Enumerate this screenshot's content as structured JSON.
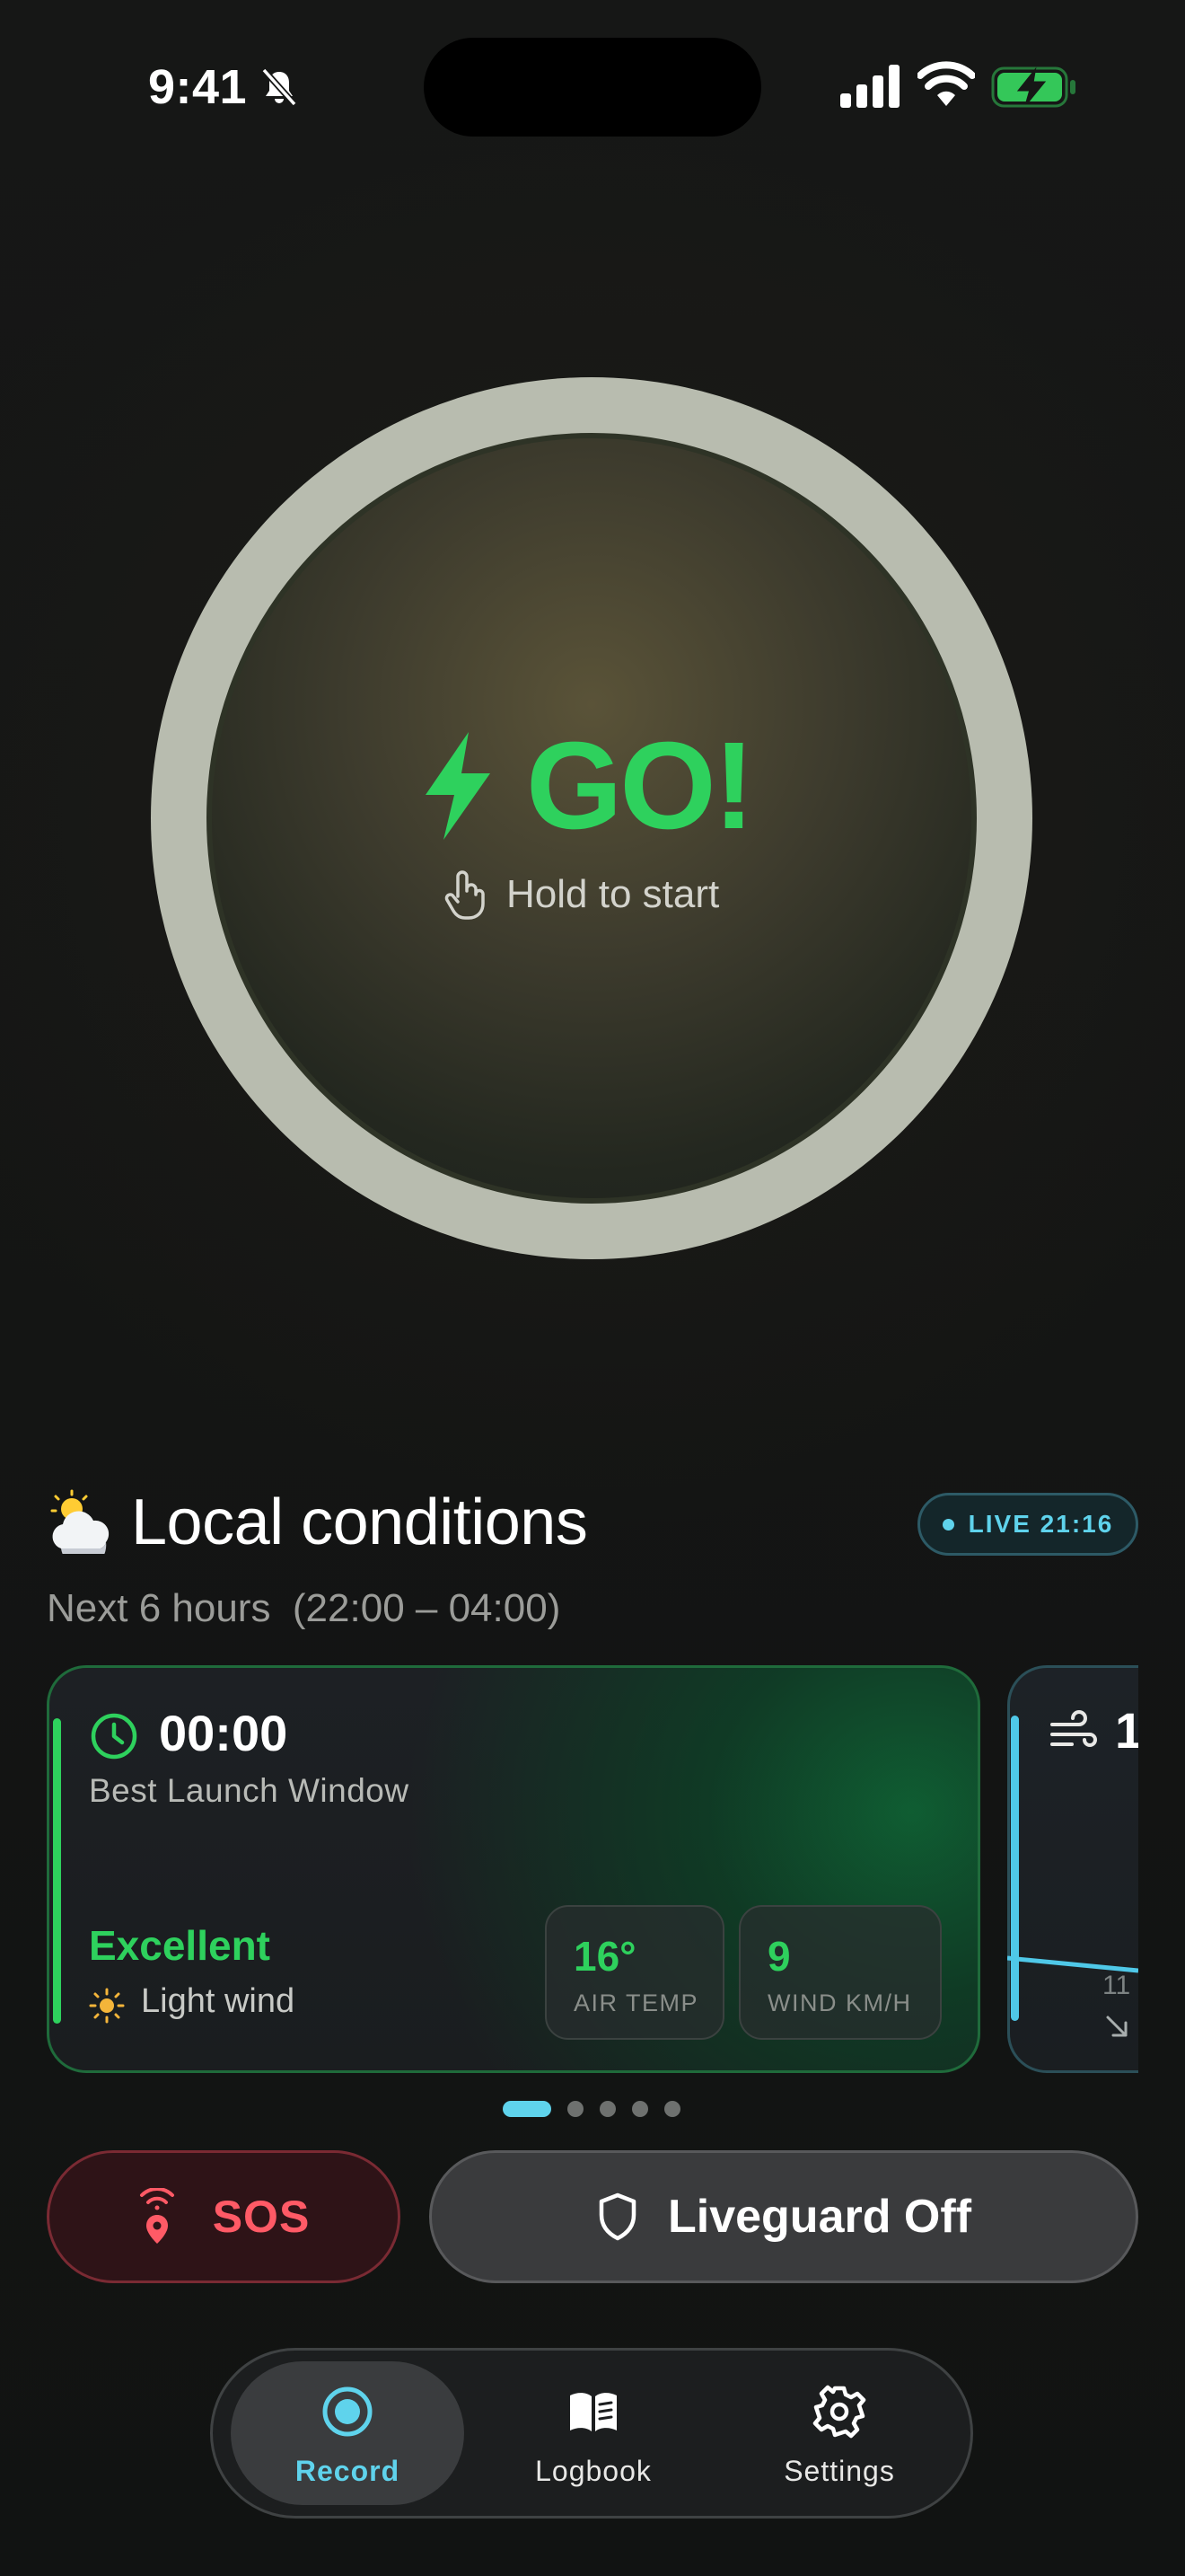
{
  "status_bar": {
    "time": "9:41",
    "icons": [
      "bell-slash-icon",
      "cellular-signal-icon",
      "wifi-icon",
      "battery-charging-icon"
    ]
  },
  "go_button": {
    "label": "GO!",
    "hint": "Hold to start",
    "icon": "lightning-bolt-icon",
    "hint_icon": "hand-tap-icon",
    "accent_color": "#2ED15D"
  },
  "conditions": {
    "emoji": "sun-behind-cloud-icon",
    "title": "Local conditions",
    "live_badge": "LIVE 21:16",
    "subtitle": "Next 6 hours  (22:00 – 04:00)",
    "cards": [
      {
        "time": "00:00",
        "label": "Best Launch Window",
        "rating": "Excellent",
        "wind_description": "Light wind",
        "stats": [
          {
            "value": "16°",
            "label": "AIR TEMP"
          },
          {
            "value": "9",
            "label": "WIND KM/H"
          }
        ]
      },
      {
        "value_partial": "1",
        "tick_label": "11",
        "icon": "wind-icon"
      }
    ],
    "page_count": 5,
    "active_page": 0
  },
  "actions": {
    "sos_label": "SOS",
    "liveguard_label": "Liveguard Off"
  },
  "tabbar": {
    "items": [
      {
        "label": "Record",
        "icon": "record-icon",
        "active": true
      },
      {
        "label": "Logbook",
        "icon": "book-icon",
        "active": false
      },
      {
        "label": "Settings",
        "icon": "gear-icon",
        "active": false
      }
    ]
  },
  "colors": {
    "accent_green": "#2ED15D",
    "accent_cyan": "#5FD3EC",
    "sos_red": "#FF5A66"
  }
}
